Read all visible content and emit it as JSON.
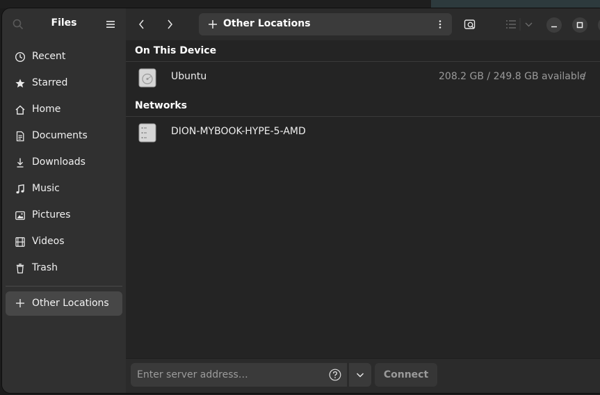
{
  "sidebar": {
    "title": "Files",
    "items": [
      {
        "label": "Recent",
        "icon": "clock-icon"
      },
      {
        "label": "Starred",
        "icon": "star-icon"
      },
      {
        "label": "Home",
        "icon": "home-icon"
      },
      {
        "label": "Documents",
        "icon": "document-icon"
      },
      {
        "label": "Downloads",
        "icon": "download-icon"
      },
      {
        "label": "Music",
        "icon": "music-note-icon"
      },
      {
        "label": "Pictures",
        "icon": "picture-icon"
      },
      {
        "label": "Videos",
        "icon": "film-icon"
      },
      {
        "label": "Trash",
        "icon": "trash-icon"
      }
    ],
    "other_locations_label": "Other Locations"
  },
  "header": {
    "path_label": "Other Locations"
  },
  "main": {
    "device_section_title": "On This Device",
    "devices": [
      {
        "name": "Ubuntu",
        "available": "208.2 GB / 249.8 GB available",
        "mount": "/"
      }
    ],
    "network_section_title": "Networks",
    "networks": [
      {
        "name": "DION-MYBOOK-HYPE-5-AMD"
      }
    ]
  },
  "bottom": {
    "server_placeholder": "Enter server address…",
    "connect_label": "Connect"
  },
  "colors": {
    "sidebar_bg": "#303030",
    "main_bg": "#242424",
    "selected_item_bg": "#474747",
    "dim_text": "#9a9a9a"
  }
}
